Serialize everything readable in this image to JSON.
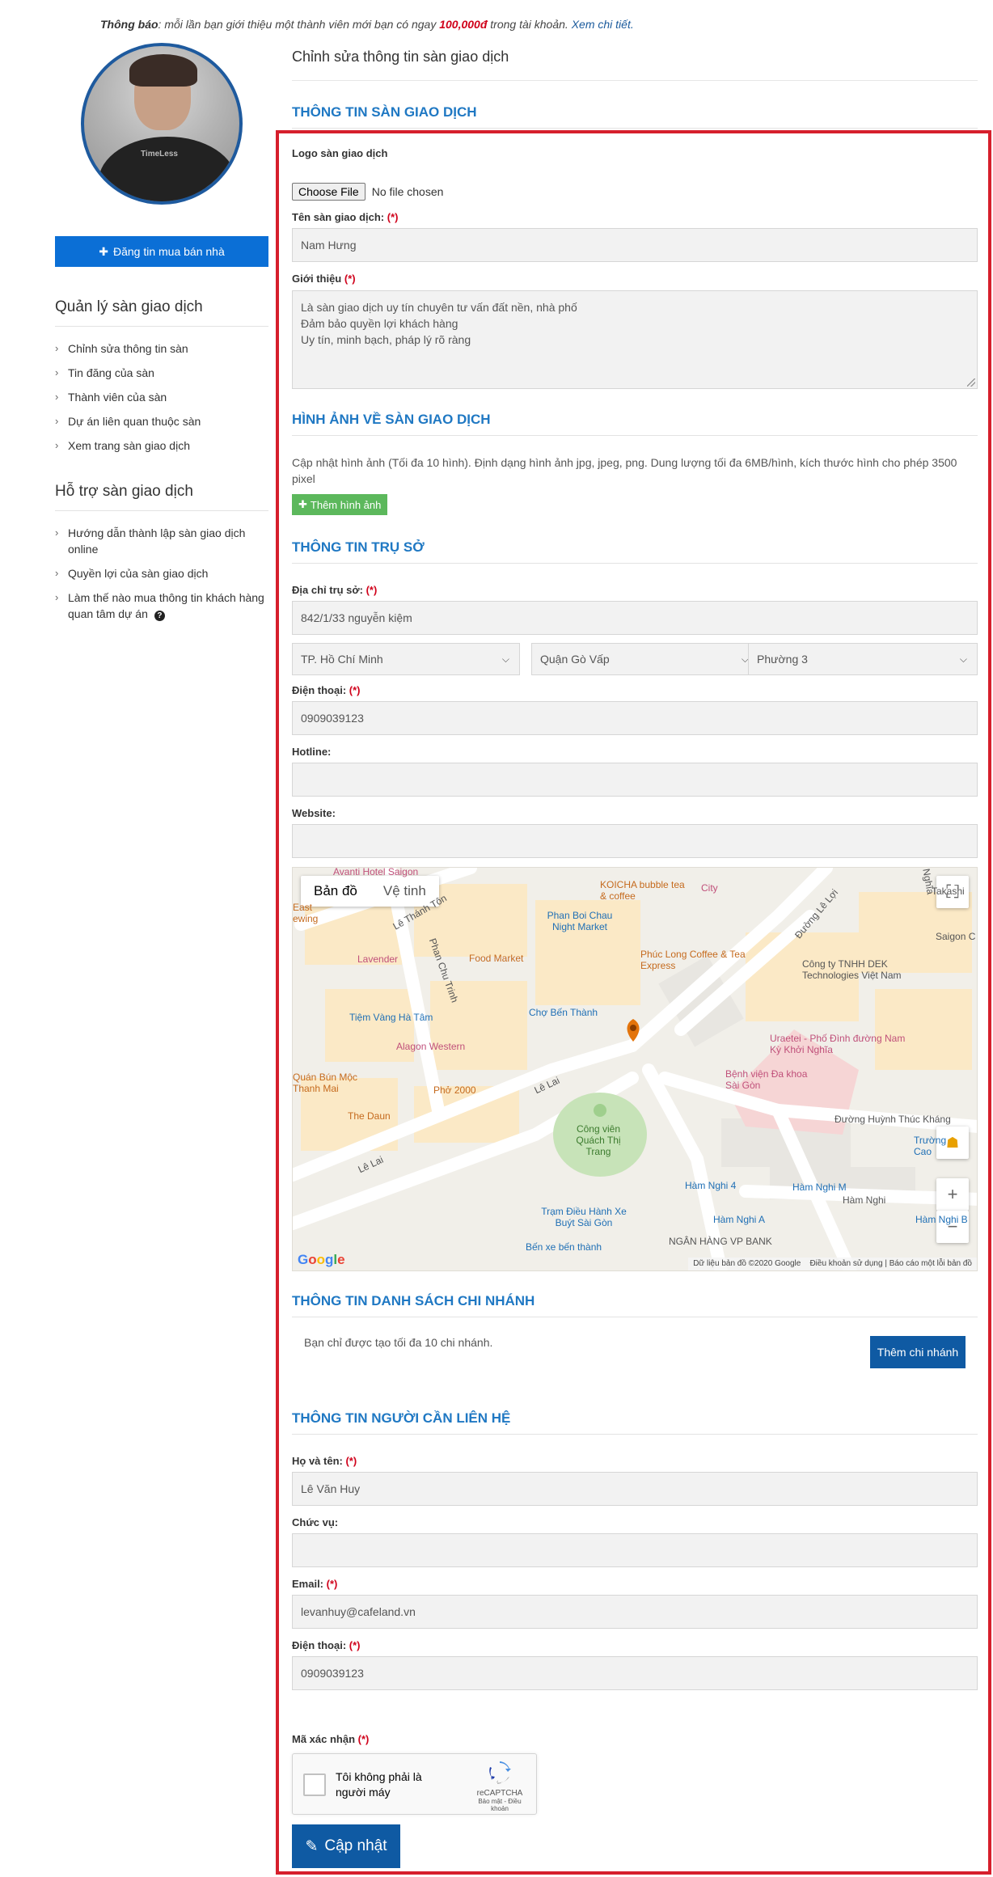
{
  "notice": {
    "label": "Thông báo",
    "text_before": ": mỗi lần bạn giới thiệu một thành viên mới bạn có ngay ",
    "amount": "100,000đ",
    "text_after": " trong tài khoản. ",
    "link": "Xem chi tiết."
  },
  "sidebar": {
    "avatar_shirt_text": "TimeLess",
    "post_button": "Đăng tin mua bán nhà",
    "manage_title": "Quản lý sàn giao dịch",
    "manage_items": [
      "Chỉnh sửa thông tin sàn",
      "Tin đăng của sàn",
      "Thành viên của sàn",
      "Dự án liên quan thuộc sàn",
      "Xem trang sàn giao dịch"
    ],
    "support_title": "Hỗ trợ sàn giao dịch",
    "support_items": [
      "Hướng dẫn thành lập sàn giao dịch online",
      "Quyền lợi của sàn giao dịch",
      "Làm thế nào mua thông tin khách hàng quan tâm dự án"
    ]
  },
  "main": {
    "page_title": "Chỉnh sửa thông tin sàn giao dịch",
    "sections": {
      "exchange_info": "THÔNG TIN SÀN GIAO DỊCH",
      "images": "HÌNH ẢNH VỀ SÀN GIAO DỊCH",
      "headquarters": "THÔNG TIN TRỤ SỞ",
      "branches": "THÔNG TIN DANH SÁCH CHI NHÁNH",
      "contact": "THÔNG TIN NGƯỜI CẦN LIÊN HỆ"
    },
    "logo": {
      "label": "Logo sàn giao dịch",
      "button": "Choose File",
      "status": "No file chosen"
    },
    "name": {
      "label": "Tên sàn giao dịch: ",
      "required": "(*)",
      "value": "Nam Hưng"
    },
    "intro": {
      "label": "Giới thiệu ",
      "required": "(*)",
      "value": "Là sàn giao dịch uy tín chuyên tư vấn đất nền, nhà phố\nĐảm bảo quyền lợi khách hàng\nUy tín, minh bạch, pháp lý rõ ràng"
    },
    "images": {
      "note": "Cập nhật hình ảnh (Tối đa 10 hình). Định dạng hình ảnh jpg, jpeg, png. Dung lượng tối đa 6MB/hình, kích thước hình cho phép 3500 pixel",
      "add_button": "Thêm hình ảnh"
    },
    "address": {
      "label": "Địa chỉ trụ sở: ",
      "required": "(*)",
      "value": "842/1/33 nguyễn kiệm"
    },
    "city": "TP. Hồ Chí Minh",
    "district": "Quận Gò Vấp",
    "ward": "Phường 3",
    "phone": {
      "label": "Điện thoại: ",
      "required": "(*)",
      "value": "0909039123"
    },
    "hotline": {
      "label": "Hotline:",
      "value": ""
    },
    "website": {
      "label": "Website:",
      "value": ""
    },
    "map": {
      "tab_map": "Bản đồ",
      "tab_satellite": "Vệ tinh",
      "footer_data": "Dữ liệu bản đồ ©2020 Google",
      "footer_terms": "Điều khoản sử dụng",
      "footer_report": "Báo cáo một lỗi bản đồ",
      "google": "Google",
      "labels": [
        "Avanti Hotel Saigon",
        "KOICHA bubble tea & coffee",
        "City",
        "Lê Thánh Tôn",
        "Phan Boi Chau Night Market",
        "Đường Lê Lợi",
        "Phúc Long Coffee & Tea Express",
        "Saigon C",
        "Lavender",
        "Food Market",
        "Phan Chu Trinh",
        "Công ty TNHH DEK Technologies Việt Nam",
        "Tiệm Vàng Hà Tâm",
        "Chợ Bến Thành",
        "Alagon Western",
        "Uraetei - Phố Đình đường Nam Kỳ Khởi Nghĩa",
        "Quán Bún Mộc Thanh Mai",
        "Phở 2000",
        "Lê Lai",
        "Bệnh viện Đa khoa Sài Gòn",
        "The Daun",
        "Công viên Quách Thị Trang",
        "Đường Huỳnh Thúc Kháng",
        "Trường Cao",
        "Hàm Nghi",
        "Trạm Điều Hành Xe Buýt Sài Gòn",
        "NGÂN HÀNG VP BANK",
        "Bến xe bến thành",
        "Lê Lai",
        "Takashi",
        "Nghĩa",
        "East",
        "ewing",
        "Hàm Nghi 4",
        "Hàm Nghi M",
        "Hàm Nghi A",
        "Hàm Nghi B"
      ]
    },
    "branches": {
      "note": "Bạn chỉ được tạo tối đa 10 chi nhánh.",
      "add_button": "Thêm chi nhánh"
    },
    "contact_name": {
      "label": "Họ và tên: ",
      "required": "(*)",
      "value": "Lê Văn Huy"
    },
    "position": {
      "label": "Chức vụ:",
      "value": ""
    },
    "email": {
      "label": "Email: ",
      "required": "(*)",
      "value": "levanhuy@cafeland.vn"
    },
    "contact_phone": {
      "label": "Điện thoại: ",
      "required": "(*)",
      "value": "0909039123"
    },
    "captcha": {
      "label": "Mã xác nhận ",
      "required": "(*)",
      "text": "Tôi không phải là người máy",
      "brand": "reCAPTCHA",
      "terms": "Bảo mật - Điều khoản"
    },
    "submit": "Cập nhật"
  },
  "colors": {
    "accent_blue": "#1f78c3",
    "button_blue": "#0f5aa3",
    "highlight_red": "#d61f2c",
    "green": "#5cb85c"
  }
}
